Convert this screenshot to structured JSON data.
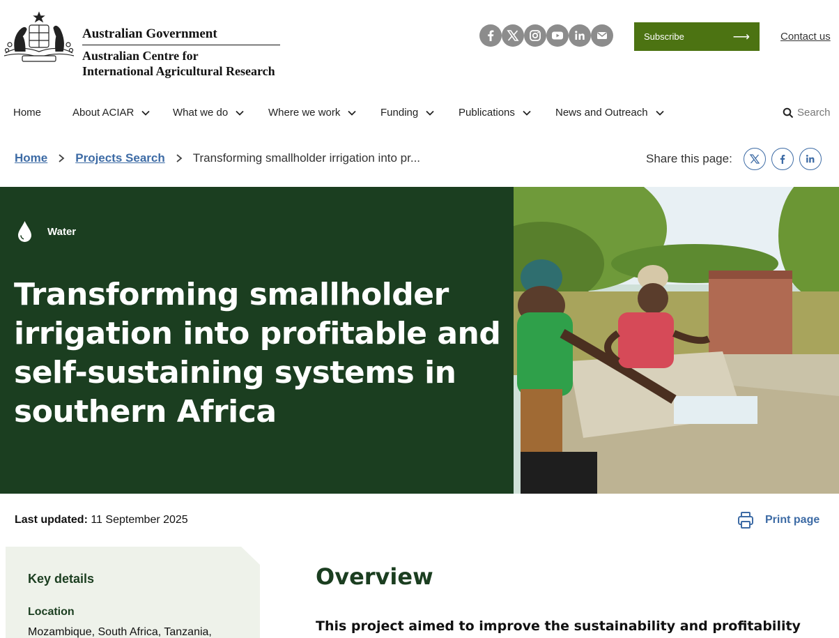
{
  "header": {
    "gov_name": "Australian Government",
    "org_line1": "Australian Centre for",
    "org_line2": "International Agricultural Research",
    "social_icons": [
      "facebook-icon",
      "x-icon",
      "instagram-icon",
      "youtube-icon",
      "linkedin-icon",
      "email-icon"
    ],
    "subscribe_label": "Subscribe",
    "subscribe_arrow": "⟶",
    "contact_label": "Contact us",
    "accent": "#4c7312"
  },
  "nav": {
    "items": [
      {
        "label": "Home"
      },
      {
        "label": "About ACIAR"
      },
      {
        "label": "What we do"
      },
      {
        "label": "Where we work"
      },
      {
        "label": "Funding"
      },
      {
        "label": "Publications"
      },
      {
        "label": "News and Outreach"
      }
    ],
    "search_label": "Search"
  },
  "breadcrumb": {
    "home": "Home",
    "projects": "Projects Search",
    "current": "Transforming smallholder irrigation into pr..."
  },
  "share": {
    "label": "Share this page:",
    "icons": [
      "x-icon",
      "facebook-icon",
      "linkedin-icon"
    ]
  },
  "hero": {
    "theme": "Water",
    "title": "Transforming smallholder irrigation into profitable and self-sustaining systems in southern Africa",
    "panel_color": "#1b3e20"
  },
  "meta": {
    "updated_label": "Last updated:",
    "updated_value": "11 September 2025",
    "print_label": "Print page"
  },
  "key_details": {
    "title": "Key details",
    "location_label": "Location",
    "location_value": "Mozambique, South Africa, Tanzania,"
  },
  "overview": {
    "heading": "Overview",
    "lead": "This project aimed to improve the sustainability and profitability of"
  }
}
